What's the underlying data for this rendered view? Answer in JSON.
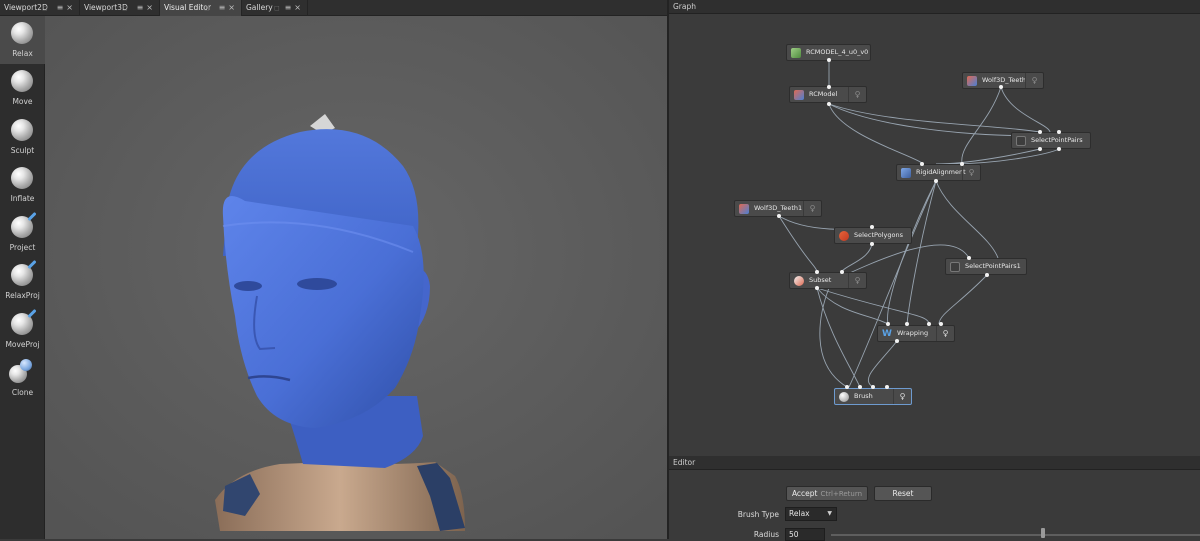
{
  "tabs": [
    {
      "label": "Viewport2D",
      "active": false
    },
    {
      "label": "Viewport3D",
      "active": false
    },
    {
      "label": "Visual Editor",
      "active": true
    },
    {
      "label": "Gallery",
      "active": false
    }
  ],
  "tools": [
    {
      "label": "Relax",
      "active": true,
      "accent": false
    },
    {
      "label": "Move",
      "active": false,
      "accent": false
    },
    {
      "label": "Sculpt",
      "active": false,
      "accent": false
    },
    {
      "label": "Inflate",
      "active": false,
      "accent": false
    },
    {
      "label": "Project",
      "active": false,
      "accent": true
    },
    {
      "label": "RelaxProj",
      "active": false,
      "accent": true
    },
    {
      "label": "MoveProj",
      "active": false,
      "accent": true
    },
    {
      "label": "Clone",
      "active": false,
      "accent": true
    }
  ],
  "graph": {
    "title": "Graph",
    "nodes": {
      "rcmodel_file": "RCMODEL_4_u0_v0",
      "rcmodel": "RCModel",
      "wolf3d_teeth": "Wolf3D_Teeth",
      "select_point_pairs": "SelectPointPairs",
      "rigid_alignment": "RigidAlignment",
      "wolf3d_teeth1": "Wolf3D_Teeth1",
      "select_polygons": "SelectPolygons",
      "subset": "Subset",
      "select_point_pairs1": "SelectPointPairs1",
      "wrapping": "Wrapping",
      "brush": "Brush"
    }
  },
  "editor": {
    "title": "Editor",
    "accept_label": "Accept",
    "accept_shortcut": "Ctrl+Return",
    "reset_label": "Reset",
    "brush_type_label": "Brush Type",
    "brush_type_value": "Relax",
    "radius_label": "Radius",
    "radius_value": "50"
  },
  "colors": {
    "accent": "#5aa2e6",
    "face_blue": "#4a6fd6",
    "selection": "#6e9bd0"
  }
}
